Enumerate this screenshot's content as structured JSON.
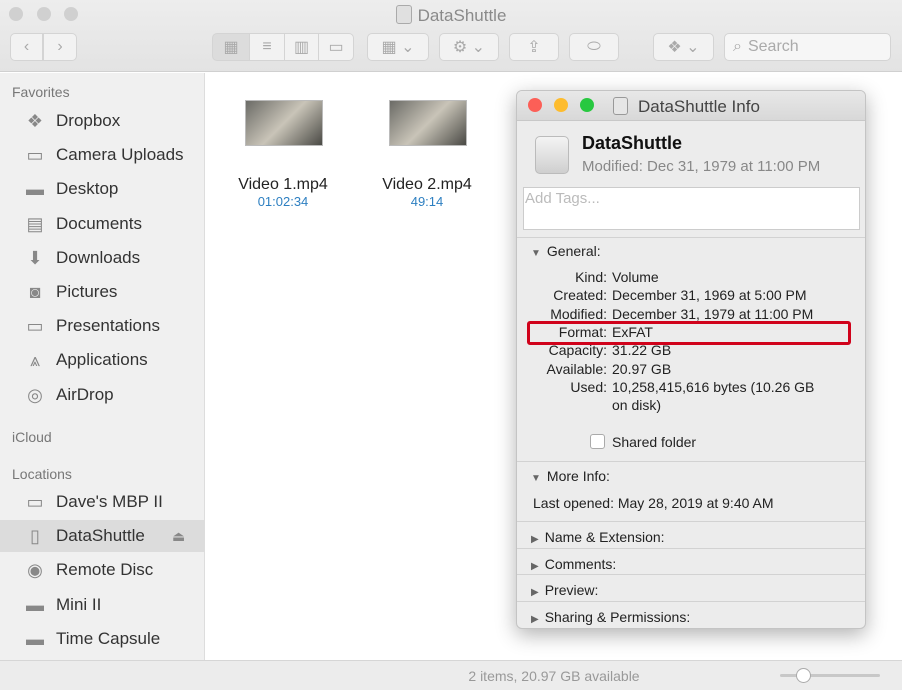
{
  "window": {
    "title": "DataShuttle"
  },
  "toolbar": {
    "search_placeholder": "Search"
  },
  "sidebar": {
    "favorites_header": "Favorites",
    "favorites": [
      {
        "label": "Dropbox",
        "icon": "dropbox-icon"
      },
      {
        "label": "Camera Uploads",
        "icon": "folder-icon"
      },
      {
        "label": "Desktop",
        "icon": "desktop-icon"
      },
      {
        "label": "Documents",
        "icon": "documents-icon"
      },
      {
        "label": "Downloads",
        "icon": "downloads-icon"
      },
      {
        "label": "Pictures",
        "icon": "camera-icon"
      },
      {
        "label": "Presentations",
        "icon": "folder-icon"
      },
      {
        "label": "Applications",
        "icon": "applications-icon"
      },
      {
        "label": "AirDrop",
        "icon": "airdrop-icon"
      }
    ],
    "icloud_header": "iCloud",
    "locations_header": "Locations",
    "locations": [
      {
        "label": "Dave's MBP II",
        "icon": "laptop-icon"
      },
      {
        "label": "DataShuttle",
        "icon": "drive-icon",
        "selected": true
      },
      {
        "label": "Remote Disc",
        "icon": "disc-icon"
      },
      {
        "label": "Mini II",
        "icon": "mac-mini-icon"
      },
      {
        "label": "Time Capsule",
        "icon": "time-capsule-icon"
      }
    ]
  },
  "files": [
    {
      "name": "Video 1.mp4",
      "duration": "01:02:34"
    },
    {
      "name": "Video 2.mp4",
      "duration": "49:14"
    }
  ],
  "status": "2 items, 20.97 GB available",
  "info": {
    "title": "DataShuttle Info",
    "name": "DataShuttle",
    "modified_summary": "Modified: Dec 31, 1979 at 11:00 PM",
    "tags_placeholder": "Add Tags...",
    "general_label": "General:",
    "rows": [
      {
        "label": "Kind:",
        "value": "Volume"
      },
      {
        "label": "Created:",
        "value": "December 31, 1969 at 5:00 PM"
      },
      {
        "label": "Modified:",
        "value": "December 31, 1979 at 11:00 PM"
      },
      {
        "label": "Format:",
        "value": "ExFAT"
      },
      {
        "label": "Capacity:",
        "value": "31.22 GB"
      },
      {
        "label": "Available:",
        "value": "20.97 GB"
      },
      {
        "label": "Used:",
        "value": "10,258,415,616 bytes (10.26 GB"
      },
      {
        "label": "",
        "value": "on disk)"
      }
    ],
    "shared_folder": "Shared folder",
    "shared_checked": false,
    "more_info_label": "More Info:",
    "last_opened": "Last opened: May 28, 2019 at 9:40 AM",
    "sections": [
      "Name & Extension:",
      "Comments:",
      "Preview:",
      "Sharing & Permissions:"
    ],
    "highlight_color": "#d0021b"
  }
}
